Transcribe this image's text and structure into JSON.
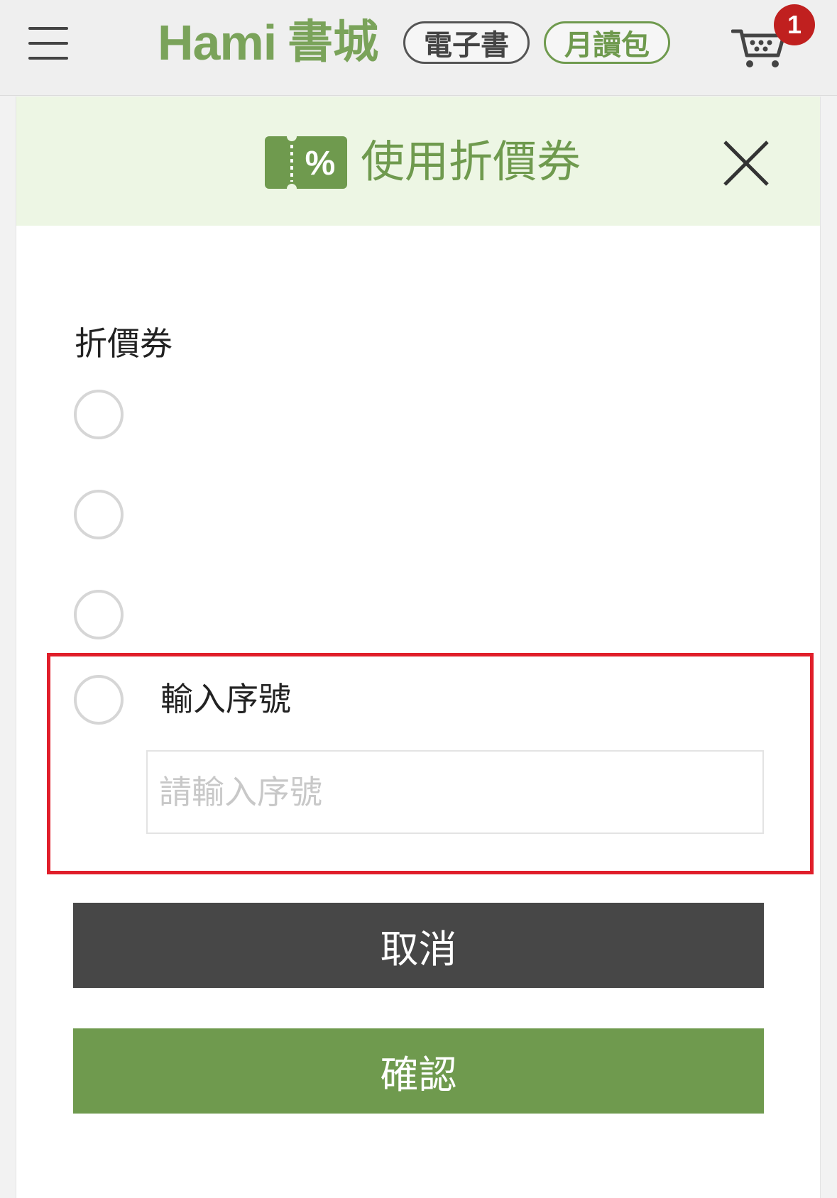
{
  "header": {
    "logo_latin": "Hami",
    "logo_cjk": "書城",
    "tab_ebook": "電子書",
    "tab_monthly": "月讀包",
    "cart_count": "1",
    "menu_icon": "hamburger-icon",
    "cart_icon": "shopping-cart-icon"
  },
  "dialog": {
    "title": "使用折價券",
    "title_icon": "coupon-percent-icon",
    "close_icon": "close-icon",
    "section_label": "折價券",
    "serial_option_label": "輸入序號",
    "serial_input_placeholder": "請輸入序號",
    "serial_input_value": "",
    "cancel_label": "取消",
    "confirm_label": "確認"
  },
  "colors": {
    "brand_green": "#6f9a4e",
    "header_bg": "#edf6e4",
    "badge_red": "#c0201f",
    "highlight_red": "#e01e2a",
    "cancel_bg": "#474747"
  }
}
